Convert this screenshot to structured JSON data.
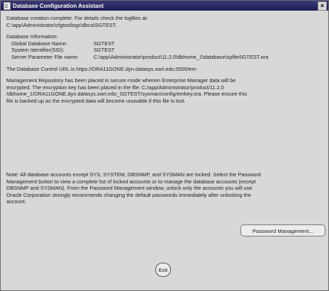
{
  "window": {
    "title": "Database Configuration Assistant",
    "close_glyph": "×"
  },
  "creation": {
    "line1": "Database creation complete. For details check the logfiles at:",
    "line2": "C:\\app\\Administrator\\cfgtoollogs\\dbca\\SGTEST."
  },
  "db_info": {
    "heading": "Database Information:",
    "rows": [
      {
        "label": "Global Database Name:",
        "value": "SGTEST"
      },
      {
        "label": "System Identifier(SID):",
        "value": "SGTEST"
      },
      {
        "label": "Server Parameter File name:",
        "value": "C:\\app\\Administrator\\product\\11.2.0\\dbhome_1\\database\\spfileSGTEST.ora"
      }
    ]
  },
  "db_control_url": "The Database Control URL is https://ORA11GONE.dyn.datasys.swri.edu:5500/em",
  "repository_note": {
    "line1": "Management Repository has been placed in secure mode wherein Enterprise Manager data will be",
    "line2": "encrypted.  The encryption key has been placed in the file: C:/app/Administrator/product/11.2.0",
    "line3": "/dbhome_1/ORA11GONE.dyn.datasys.swri.edu_SGTEST/sysman/config/emkey.ora.   Please ensure this",
    "line4": "file is backed up as the encrypted data will become unusable if this file is lost."
  },
  "accounts_note": {
    "line1": "Note: All database accounts except SYS, SYSTEM, DBSNMP, and SYSMAN are locked. Select the Password",
    "line2": "Management button to view a complete list of locked accounts or to manage the database accounts (except",
    "line3": "DBSNMP and SYSMAN). From the Password Management window, unlock only the accounts you will use.",
    "line4": "Oracle Corporation strongly recommends changing the default passwords immediately after unlocking the",
    "line5": "account."
  },
  "buttons": {
    "password_management": "Password Management...",
    "exit": "Exit"
  }
}
